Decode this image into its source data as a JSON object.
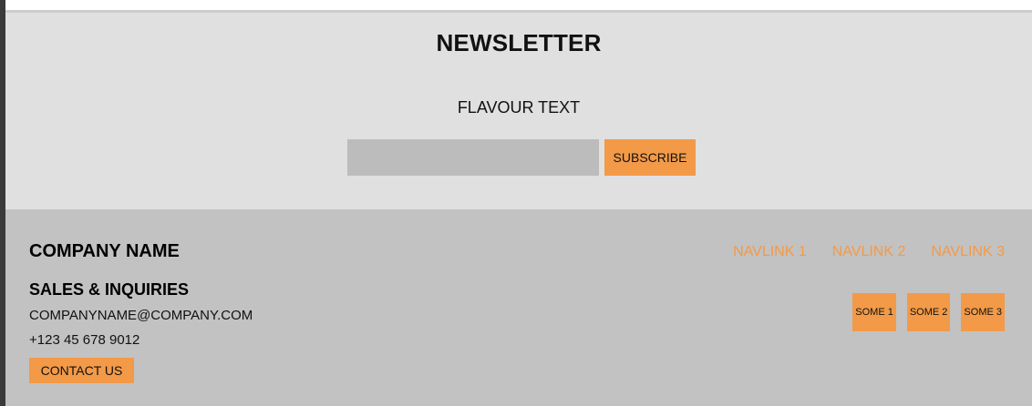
{
  "newsletter": {
    "title": "NEWSLETTER",
    "flavour": "FLAVOUR TEXT",
    "input_value": "",
    "input_placeholder": "",
    "subscribe_label": "SUBSCRIBE"
  },
  "footer": {
    "company_name": "COMPANY NAME",
    "sales_heading": "SALES & INQUIRIES",
    "email": "COMPANYNAME@COMPANY.COM",
    "phone": "+123 45 678 9012",
    "contact_label": "CONTACT US",
    "navlinks": [
      "NAVLINK 1",
      "NAVLINK 2",
      "NAVLINK 3"
    ],
    "socials": [
      "SOME 1",
      "SOME 2",
      "SOME 3"
    ]
  },
  "colors": {
    "accent": "#f29a48",
    "newsletter_bg": "#e0e0e0",
    "footer_bg": "#c2c2c2",
    "input_bg": "#bcbcbc"
  }
}
